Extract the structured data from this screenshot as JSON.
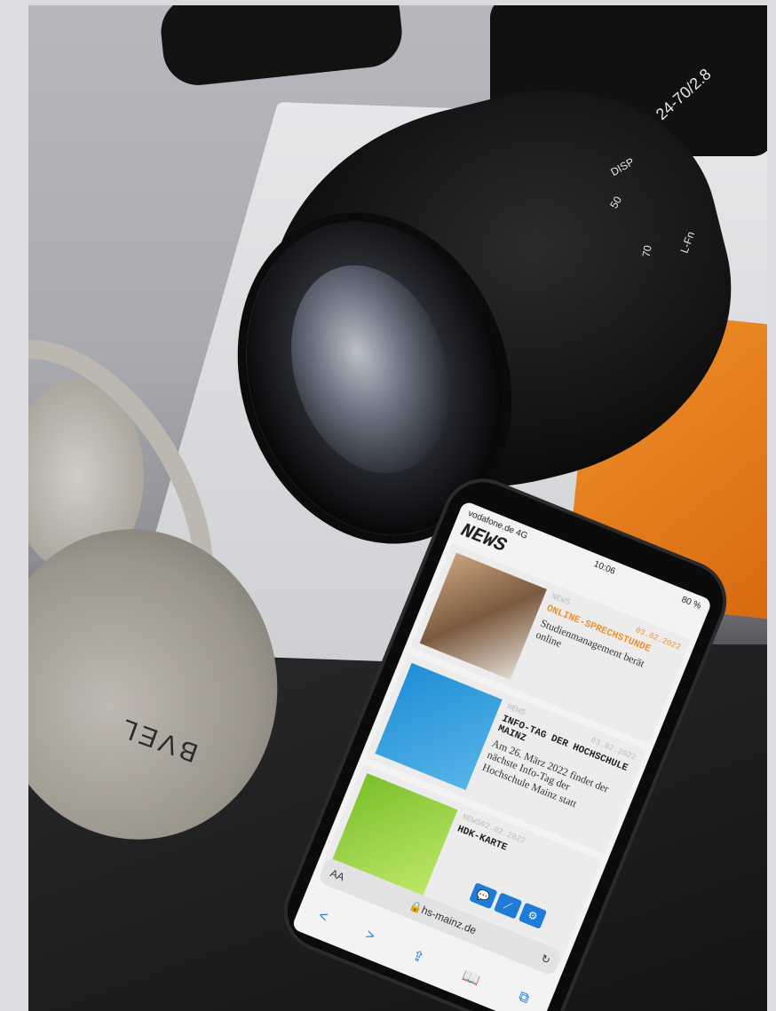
{
  "lens": {
    "focal_top": "24-70/2.8",
    "mark_disp": "DISP",
    "mark_50": "50",
    "mark_70": "70",
    "mark_lfn": "L-Fn"
  },
  "headphones": {
    "logo": "BVEL"
  },
  "phone": {
    "status": {
      "carrier": "vodafone.de 4G",
      "time": "10:06",
      "battery": "80 %"
    },
    "page_title": "NEWS",
    "cards": [
      {
        "category": "NEWS",
        "date": "03.02.2022",
        "headline": "ONLINE-SPRECHSTUNDE",
        "text": "Studienmanagement berät online"
      },
      {
        "category": "NEWS",
        "date": "03.02.2022",
        "headline": "INFO-TAG DER HOCHSCHULE MAINZ",
        "text": "Am 26. März 2022 findet der nächste Info-Tag der Hochschule Mainz statt"
      },
      {
        "category": "NEWS",
        "date": "02.02.2022",
        "headline": "HDK-KARTE",
        "text": ""
      }
    ],
    "url_bar": {
      "aa": "AA",
      "url": "hs-mainz.de"
    },
    "toolbar": {
      "back": "<",
      "forward": ">",
      "share": "⇪",
      "bookmarks": "📖",
      "tabs": "⧉"
    },
    "fab_icons": [
      "chat-icon",
      "chart-icon",
      "gear-icon"
    ]
  },
  "colors": {
    "accent_orange": "#f0902a",
    "link_blue": "#1e7bd8"
  }
}
